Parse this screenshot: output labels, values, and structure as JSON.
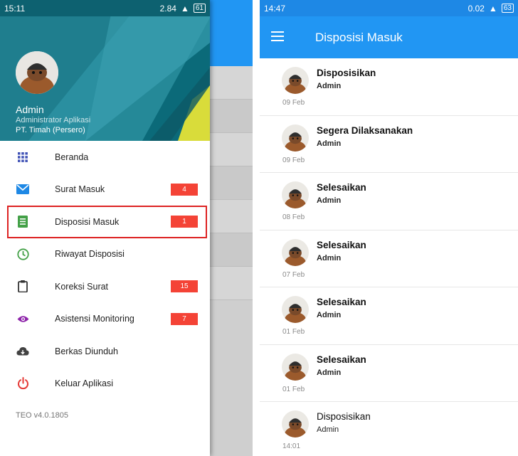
{
  "left_status": {
    "time": "15:11",
    "right": "2.84",
    "battery": "61"
  },
  "right_status": {
    "time": "14:47",
    "right": "0.02",
    "battery": "63"
  },
  "drawer": {
    "profile": {
      "name": "Admin",
      "role": "Administrator Aplikasi",
      "org": "PT. Timah (Persero)"
    },
    "items": [
      {
        "label": "Beranda",
        "icon": "grid-icon",
        "badge": ""
      },
      {
        "label": "Surat Masuk",
        "icon": "mail-icon",
        "badge": "4"
      },
      {
        "label": "Disposisi Masuk",
        "icon": "document-icon",
        "badge": "1"
      },
      {
        "label": "Riwayat Disposisi",
        "icon": "clock-icon",
        "badge": ""
      },
      {
        "label": "Koreksi Surat",
        "icon": "clipboard-icon",
        "badge": "15"
      },
      {
        "label": "Asistensi Monitoring",
        "icon": "eye-icon",
        "badge": "7"
      },
      {
        "label": "Berkas Diunduh",
        "icon": "cloud-download-icon",
        "badge": ""
      },
      {
        "label": "Keluar Aplikasi",
        "icon": "power-icon",
        "badge": ""
      }
    ],
    "version": "TEO v4.0.1805"
  },
  "appbar": {
    "title": "Disposisi Masuk"
  },
  "list": [
    {
      "title": "Disposisikan",
      "sender": "Admin",
      "date": "09 Feb"
    },
    {
      "title": "Segera Dilaksanakan",
      "sender": "Admin",
      "date": "09 Feb"
    },
    {
      "title": "Selesaikan",
      "sender": "Admin",
      "date": "08 Feb"
    },
    {
      "title": "Selesaikan",
      "sender": "Admin",
      "date": "07 Feb"
    },
    {
      "title": "Selesaikan",
      "sender": "Admin",
      "date": "01 Feb"
    },
    {
      "title": "Selesaikan",
      "sender": "Admin",
      "date": "01 Feb"
    },
    {
      "title": "Disposisikan",
      "sender": "Admin",
      "date": "14:01"
    }
  ],
  "colors": {
    "primary": "#2196f3",
    "badge": "#f44336",
    "highlight": "#d22222"
  }
}
